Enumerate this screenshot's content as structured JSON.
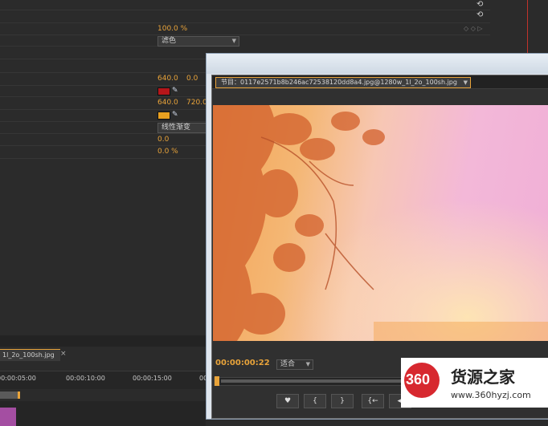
{
  "effect_controls": {
    "opacity_value": "100.0 %",
    "blend_mode": "滤色",
    "start_x": "640.0",
    "start_y": "0.0",
    "end_x": "640.0",
    "end_y": "720.0",
    "ramp_shape": "线性渐变",
    "scatter": "0.0",
    "blend_pct": "0.0 %",
    "start_color": "#b5161a",
    "end_color": "#e8a020"
  },
  "program_monitor": {
    "tab_label": "节目：0117e2571b8b246ac72538120dd8a4.jpg@1280w_1l_2o_100sh.jpg",
    "timecode": "00:00:00:22",
    "fit_option": "适合",
    "controls": [
      "♥",
      "{",
      "}",
      "{←",
      "◀"
    ]
  },
  "timeline": {
    "tab_label": "1l_2o_100sh.jpg",
    "ruler": [
      "00:00:05:00",
      "00:00:10:00",
      "00:00:15:00",
      "00:0"
    ]
  },
  "watermark": {
    "logo": "360",
    "name": "货源之家",
    "url": "www.360hyzj.com"
  }
}
